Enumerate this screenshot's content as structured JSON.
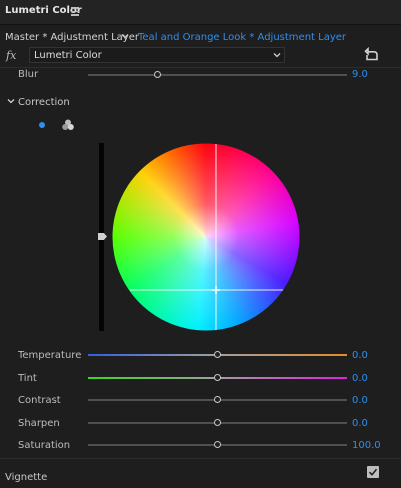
{
  "header": {
    "title": "Lumetri Color",
    "menu_icon": "hamburger-icon"
  },
  "source": {
    "master_label": "Master * Adjustment Layer",
    "clip_label": "Teal and Orange Look * Adjustment Layer"
  },
  "effect": {
    "fx_label": "fx",
    "selected": "Lumetri Color",
    "reset_icon": "reset-icon"
  },
  "blur": {
    "label": "Blur",
    "value": "9.0",
    "level": 0.27
  },
  "correction": {
    "title": "Correction",
    "modes": [
      "single-wheel",
      "three-way"
    ],
    "sliders": [
      {
        "key": "temperature",
        "label": "Temperature",
        "value": "0.0",
        "level": 0.5
      },
      {
        "key": "tint",
        "label": "Tint",
        "value": "0.0",
        "level": 0.5
      },
      {
        "key": "contrast",
        "label": "Contrast",
        "value": "0.0",
        "level": 0.5
      },
      {
        "key": "sharpen",
        "label": "Sharpen",
        "value": "0.0",
        "level": 0.5
      },
      {
        "key": "saturation",
        "label": "Saturation",
        "value": "100.0",
        "level": 0.5
      }
    ]
  },
  "vignette": {
    "label": "Vignette",
    "checked": true
  }
}
